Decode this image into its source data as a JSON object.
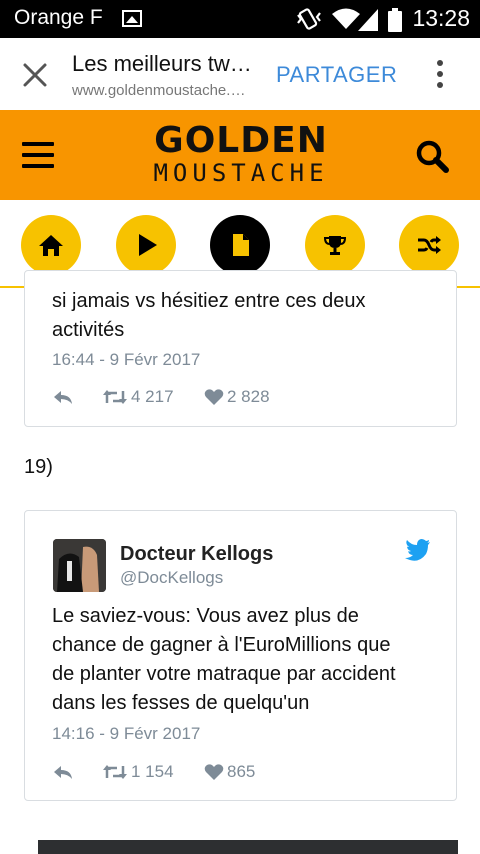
{
  "status_bar": {
    "carrier": "Orange F",
    "time": "13:28",
    "icons": [
      "gallery-icon",
      "vibrate-icon",
      "wifi-icon",
      "signal-icon",
      "battery-icon"
    ]
  },
  "browser": {
    "page_title": "Les meilleurs tweets de la semaine",
    "url": "www.goldenmoustache.com",
    "share_label": "PARTAGER"
  },
  "site": {
    "logo_line1": "GOLDEN",
    "logo_line2": "MOUSTACHE",
    "brand_color": "#f89500",
    "accent_color": "#f7c200",
    "nav_icons": [
      "home-icon",
      "play-icon",
      "document-icon",
      "trophy-icon",
      "shuffle-icon"
    ],
    "active_nav": "document-icon"
  },
  "tweet_previous": {
    "text_line1": "si jamais vs hésitiez entre ces deux",
    "text_line2": "activités",
    "time": "16:44 - 9 Févr 2017",
    "retweets": "4 217",
    "likes": "2 828"
  },
  "item_number": "19)",
  "tweet_current": {
    "author_name": "Docteur Kellogs",
    "author_handle": "@DocKellogs",
    "text_lines": [
      "Le saviez-vous: Vous avez plus de",
      "chance de gagner à l'EuroMillions que",
      "de planter votre matraque par accident",
      "dans les fesses de quelqu'un"
    ],
    "time": "14:16 - 9 Févr 2017",
    "retweets": "1 154",
    "likes": "865"
  }
}
